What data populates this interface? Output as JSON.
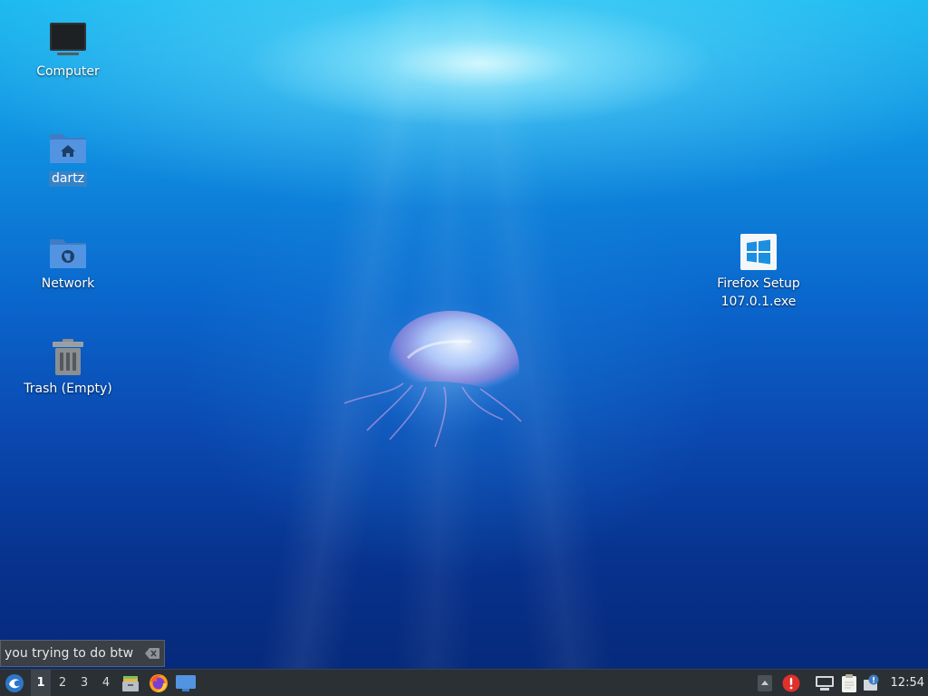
{
  "desktop": {
    "icons": [
      {
        "id": "computer",
        "label": "Computer",
        "icon": "monitor-icon"
      },
      {
        "id": "home",
        "label": "dartz",
        "icon": "home-folder-icon",
        "selected": true
      },
      {
        "id": "network",
        "label": "Network",
        "icon": "network-folder-icon"
      },
      {
        "id": "trash",
        "label": "Trash (Empty)",
        "icon": "trash-icon"
      },
      {
        "id": "firefox-setup",
        "label_line1": "Firefox Setup",
        "label_line2": "107.0.1.exe",
        "icon": "windows-logo-icon"
      }
    ]
  },
  "notification": {
    "text": "you trying to do btw",
    "clear_icon": "backspace-clear-icon"
  },
  "taskbar": {
    "menu_icon": "lxqt-start-menu-icon",
    "workspaces": [
      "1",
      "2",
      "3",
      "4"
    ],
    "active_workspace": "1",
    "launchers": [
      {
        "name": "file-manager",
        "icon": "file-manager-icon"
      },
      {
        "name": "firefox",
        "icon": "firefox-icon"
      },
      {
        "name": "show-desktop",
        "icon": "desktop-icon"
      }
    ],
    "tray": [
      {
        "name": "tray-expand",
        "icon": "up-arrow-icon"
      },
      {
        "name": "updates-alert",
        "icon": "red-alert-icon"
      },
      {
        "name": "network-status",
        "icon": "network-wired-icon"
      },
      {
        "name": "clipboard",
        "icon": "clipboard-icon"
      },
      {
        "name": "notifications",
        "icon": "notification-info-icon"
      }
    ],
    "clock": "12:54"
  },
  "colors": {
    "taskbar_bg": "#2b3034",
    "alert_red": "#e0302a",
    "folder_blue": "#5294e2"
  }
}
